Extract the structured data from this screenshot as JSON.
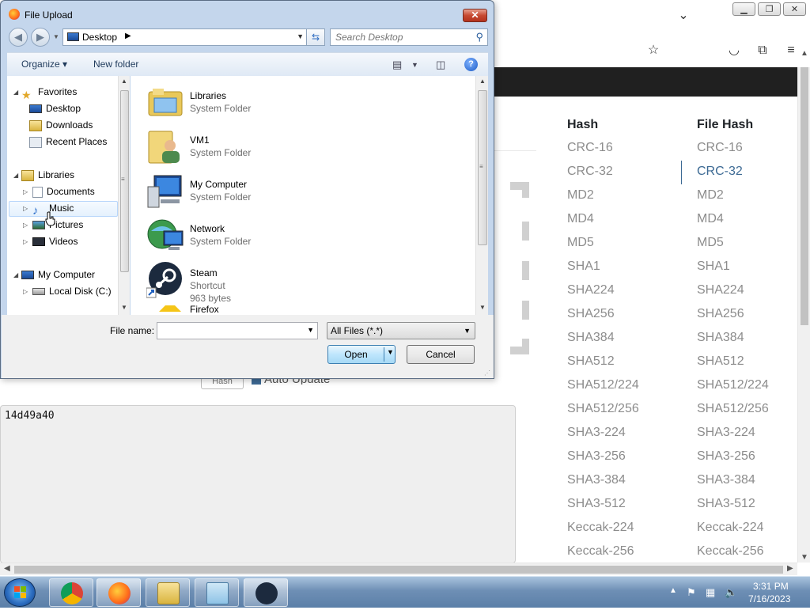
{
  "dialog": {
    "title": "File Upload",
    "address": "Desktop",
    "search_placeholder": "Search Desktop",
    "commands": {
      "organize": "Organize ▾",
      "new_folder": "New folder"
    },
    "tree": {
      "favorites": "Favorites",
      "desktop": "Desktop",
      "downloads": "Downloads",
      "recent_places": "Recent Places",
      "libraries": "Libraries",
      "documents": "Documents",
      "music": "Music",
      "pictures": "Pictures",
      "videos": "Videos",
      "my_computer": "My Computer",
      "local_disk": "Local Disk (C:)"
    },
    "files": [
      {
        "name": "Libraries",
        "type": "System Folder"
      },
      {
        "name": "VM1",
        "type": "System Folder"
      },
      {
        "name": "My Computer",
        "type": "System Folder"
      },
      {
        "name": "Network",
        "type": "System Folder"
      },
      {
        "name": "Steam",
        "type": "Shortcut",
        "size": "963 bytes"
      },
      {
        "name": "Firefox",
        "type": ""
      }
    ],
    "file_name_label": "File name:",
    "file_name_value": "",
    "file_type": "All Files (*.*)",
    "open_label": "Open",
    "cancel_label": "Cancel"
  },
  "page": {
    "output_text": "14d49a40",
    "hash_button_peek": "Hash",
    "auto_update_peek": "Auto Update",
    "hash_header": "Hash",
    "file_hash_header": "File Hash",
    "hash_items": [
      "CRC-16",
      "CRC-32",
      "MD2",
      "MD4",
      "MD5",
      "SHA1",
      "SHA224",
      "SHA256",
      "SHA384",
      "SHA512",
      "SHA512/224",
      "SHA512/256",
      "SHA3-224",
      "SHA3-256",
      "SHA3-384",
      "SHA3-512",
      "Keccak-224",
      "Keccak-256"
    ],
    "file_hash_items": [
      "CRC-16",
      "CRC-32",
      "MD2",
      "MD4",
      "MD5",
      "SHA1",
      "SHA224",
      "SHA256",
      "SHA384",
      "SHA512",
      "SHA512/224",
      "SHA512/256",
      "SHA3-224",
      "SHA3-256",
      "SHA3-384",
      "SHA3-512",
      "Keccak-224",
      "Keccak-256"
    ],
    "active_item": "CRC-32"
  },
  "taskbar": {
    "time": "3:31 PM",
    "date": "7/16/2023",
    "apps": [
      "chrome-icon",
      "firefox-icon",
      "explorer-icon",
      "notepad-icon",
      "steam-icon"
    ]
  },
  "colors": {
    "accent": "#3d6a94",
    "dark_band": "#202020"
  }
}
